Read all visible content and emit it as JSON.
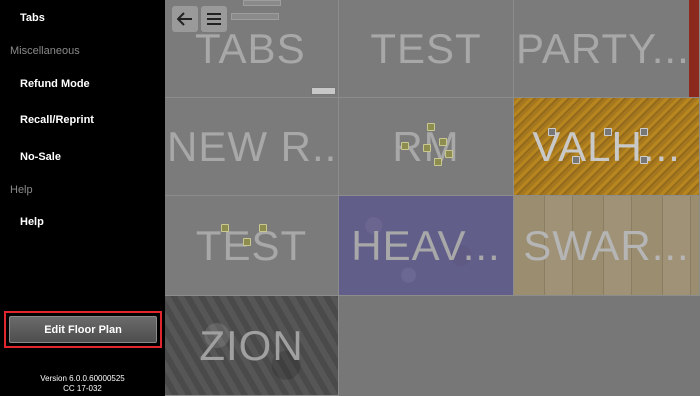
{
  "sidebar": {
    "items": [
      {
        "type": "item",
        "label": "Tabs"
      },
      {
        "type": "header",
        "label": "Miscellaneous"
      },
      {
        "type": "item",
        "label": "Refund Mode"
      },
      {
        "type": "item",
        "label": "Recall/Reprint"
      },
      {
        "type": "item",
        "label": "No-Sale"
      },
      {
        "type": "header",
        "label": "Help"
      },
      {
        "type": "item",
        "label": "Help"
      }
    ],
    "edit_button": "Edit Floor Plan",
    "version": "Version 6.0.0.60000525",
    "cc": "CC 17-032"
  },
  "toolbar": {
    "back_icon": "back-arrow-icon",
    "menu_icon": "hamburger-menu-icon"
  },
  "tiles": [
    {
      "label": "TABS"
    },
    {
      "label": "TEST"
    },
    {
      "label": "PARTY..."
    },
    {
      "label": "NEW R..."
    },
    {
      "label": "RM"
    },
    {
      "label": "VALH..."
    },
    {
      "label": "TEST"
    },
    {
      "label": "HEAV..."
    },
    {
      "label": "SWAR..."
    },
    {
      "label": "ZION"
    }
  ],
  "colors": {
    "highlight": "#e0262f",
    "tile_gray": "#7b7b7b",
    "sidebar_bg": "#000000"
  }
}
